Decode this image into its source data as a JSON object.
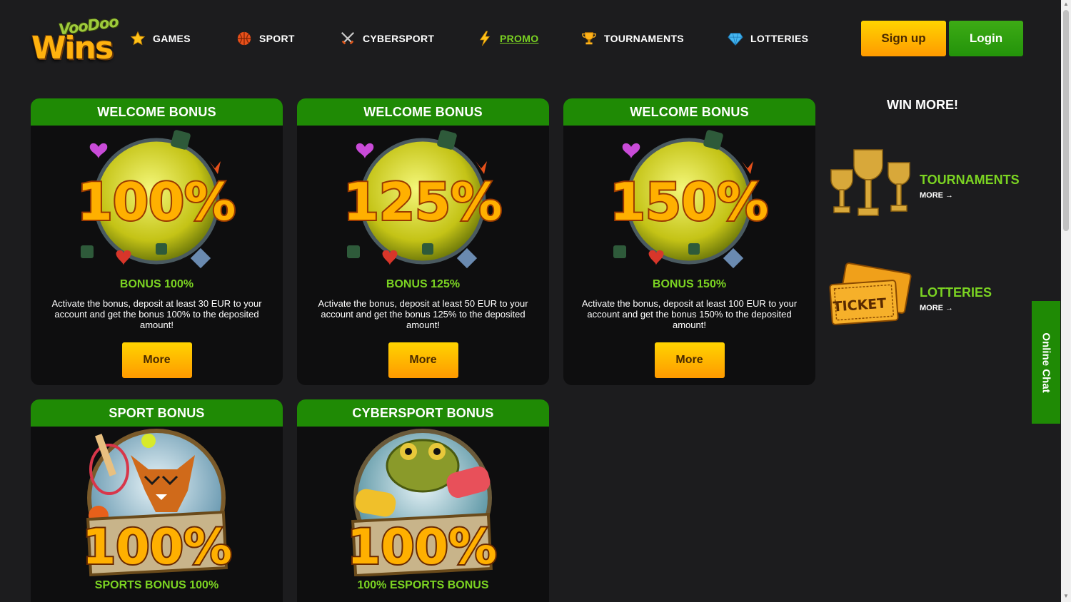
{
  "header": {
    "logo_top": "VooDoo",
    "logo_bottom": "Wins",
    "nav": [
      {
        "label": "GAMES",
        "icon": "star-icon"
      },
      {
        "label": "SPORT",
        "icon": "basketball-icon"
      },
      {
        "label": "CYBERSPORT",
        "icon": "crossed-swords-icon"
      },
      {
        "label": "PROMO",
        "icon": "lightning-icon",
        "active": true
      },
      {
        "label": "TOURNAMENTS",
        "icon": "trophy-icon"
      },
      {
        "label": "LOTTERIES",
        "icon": "diamond-icon"
      }
    ],
    "signup_label": "Sign up",
    "login_label": "Login"
  },
  "cards": [
    {
      "header": "WELCOME BONUS",
      "art_text": "100%",
      "title": "BONUS 100%",
      "desc": "Activate the bonus, deposit at least 30 EUR to your account and get the bonus 100% to the deposited amount!",
      "button": "More"
    },
    {
      "header": "WELCOME BONUS",
      "art_text": "125%",
      "title": "BONUS 125%",
      "desc": "Activate the bonus, deposit at least 50 EUR to your account and get the bonus 125% to the deposited amount!",
      "button": "More"
    },
    {
      "header": "WELCOME BONUS",
      "art_text": "150%",
      "title": "BONUS 150%",
      "desc": "Activate the bonus, deposit at least 100 EUR to your account and get the bonus 150% to the deposited amount!",
      "button": "More"
    },
    {
      "header": "SPORT BONUS",
      "art_text": "100%",
      "title": "SPORTS BONUS 100%"
    },
    {
      "header": "CYBERSPORT BONUS",
      "art_text": "100%",
      "title": "100% ESPORTS BONUS"
    }
  ],
  "sidebar": {
    "title": "WIN MORE!",
    "items": [
      {
        "label": "TOURNAMENTS",
        "more": "MORE",
        "icon": "trophies-icon"
      },
      {
        "label": "LOTTERIES",
        "more": "MORE",
        "icon": "tickets-icon",
        "ticket_text": "TICKET"
      }
    ]
  },
  "chat": {
    "label": "Online Chat"
  },
  "colors": {
    "accent_green": "#1f8a05",
    "text_green": "#7bd322",
    "button_yellow": "#ffb000",
    "background": "#1c1c1e"
  }
}
